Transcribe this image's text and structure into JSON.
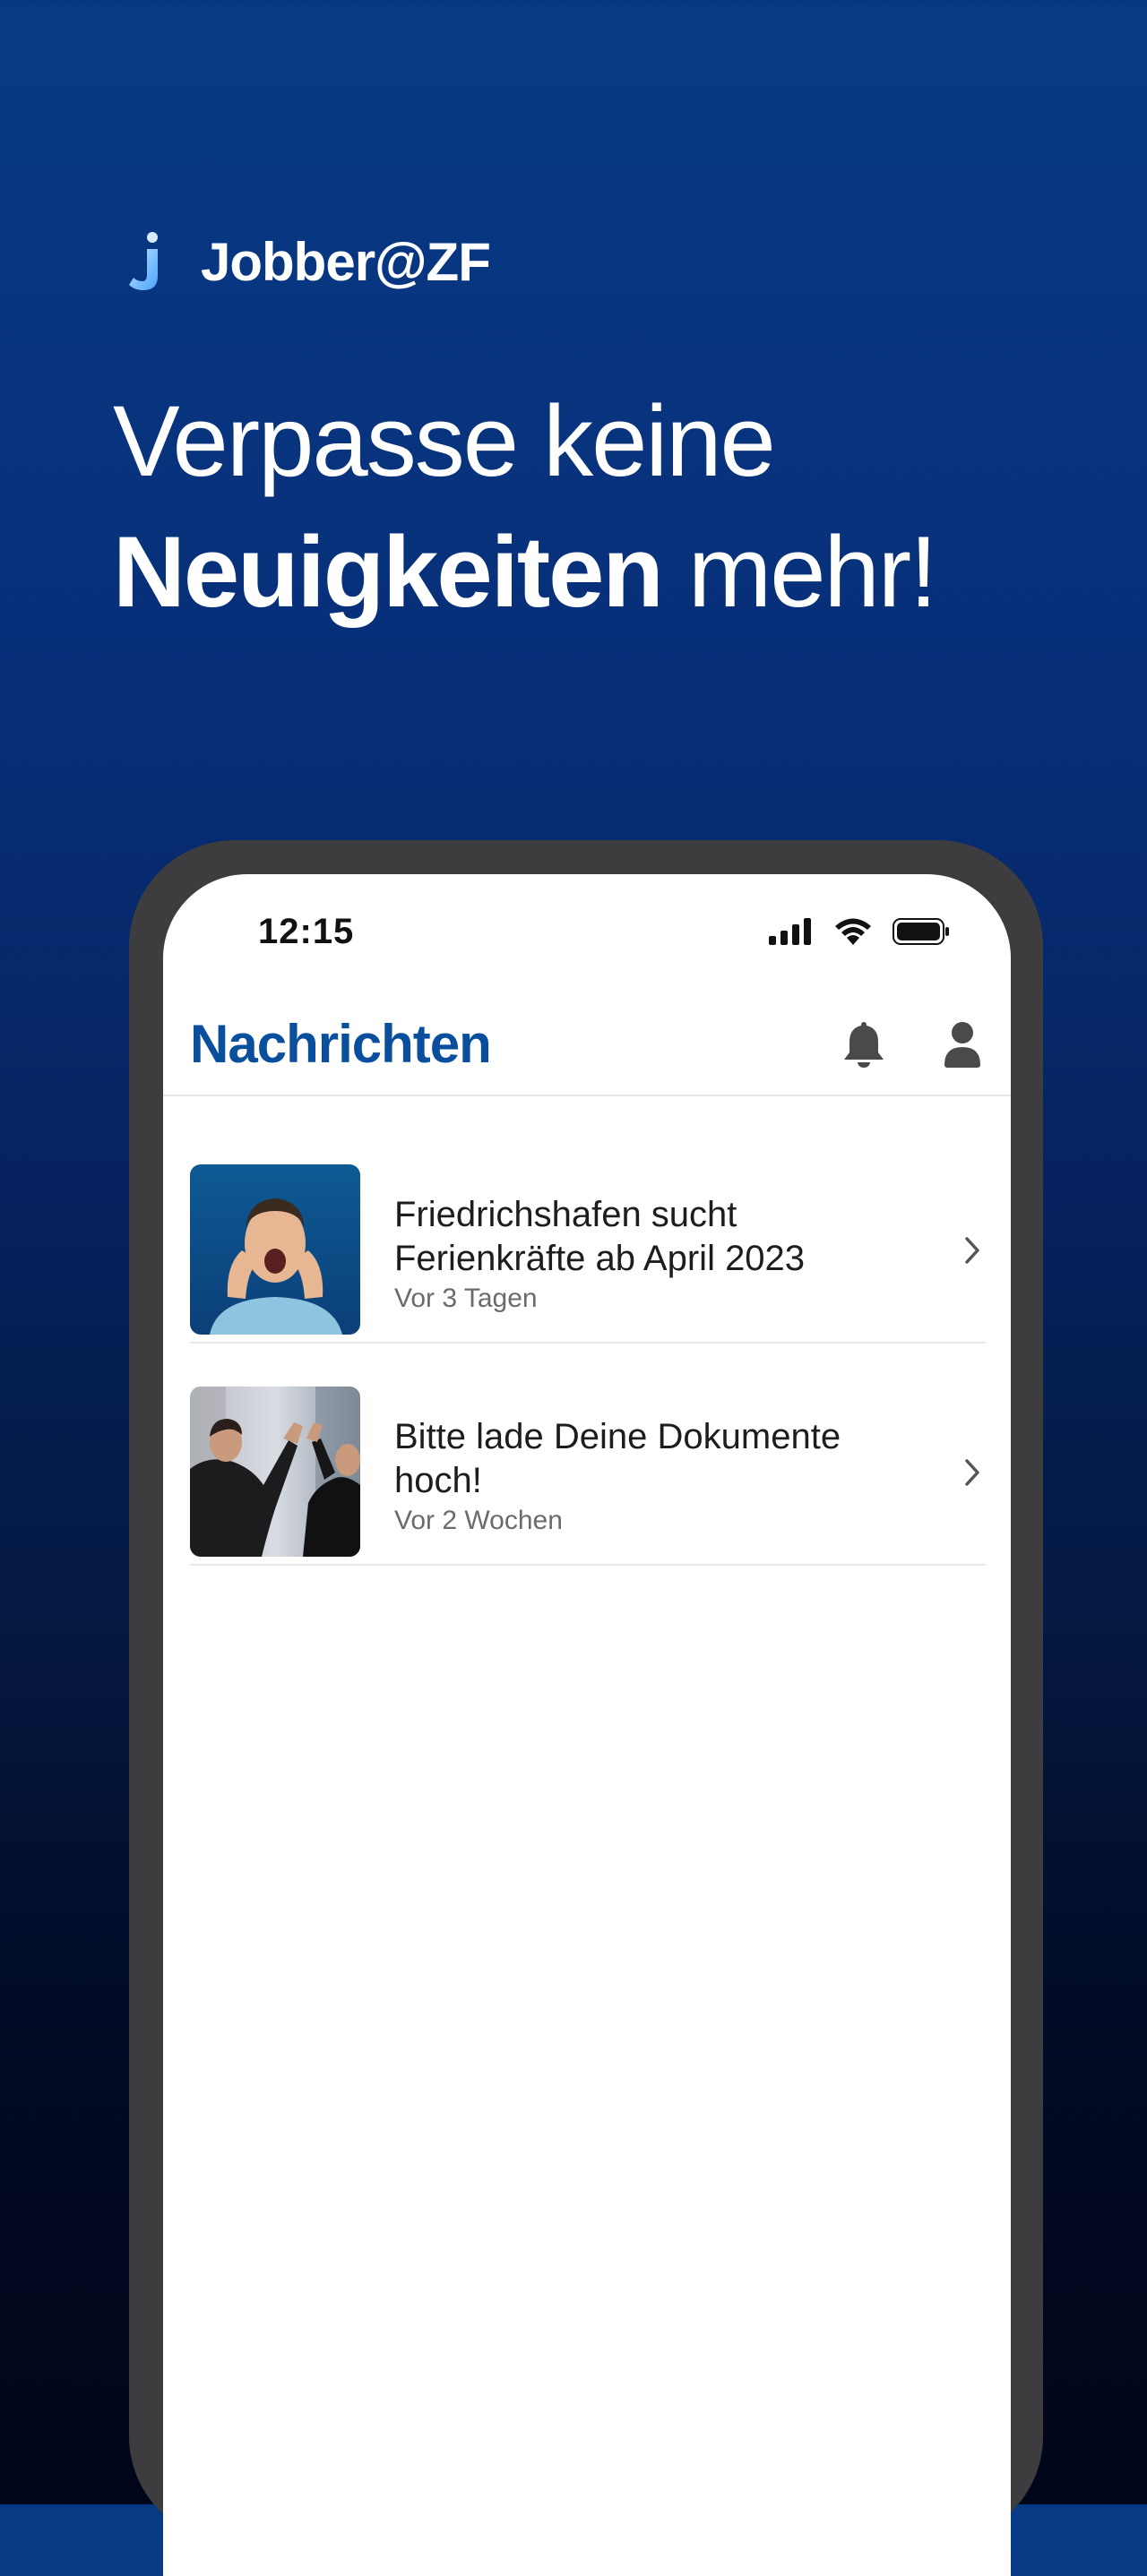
{
  "brand": {
    "name": "Jobber@ZF",
    "logo_icon": "j-logo-icon"
  },
  "headline": {
    "line1": "Verpasse keine",
    "line2_bold": "Neuigkeiten",
    "line2_rest": " mehr!"
  },
  "status_bar": {
    "time": "12:15",
    "icons": [
      "signal-icon",
      "wifi-icon",
      "battery-icon"
    ]
  },
  "header": {
    "title": "Nachrichten",
    "notification_icon": "bell-icon",
    "profile_icon": "user-icon"
  },
  "messages": [
    {
      "title": "Friedrichshafen sucht Ferienkräfte ab April 2023",
      "time": "Vor 3 Tagen",
      "thumbnail": "man-shouting-image"
    },
    {
      "title": "Bitte lade Deine Dokumente hoch!",
      "time": "Vor 2 Wochen",
      "thumbnail": "business-high-five-image"
    }
  ],
  "colors": {
    "accent": "#0a4f9e",
    "background_top": "#073a85",
    "background_bottom": "#010519"
  }
}
